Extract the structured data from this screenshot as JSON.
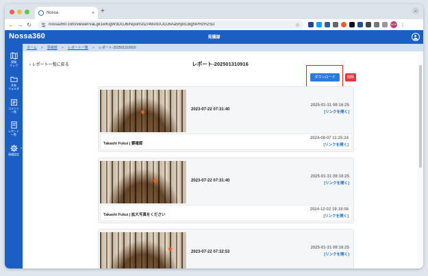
{
  "browser": {
    "tab_title": "Nossa",
    "tab_close": "×",
    "new_tab": "+",
    "tab_menu": "⌄",
    "url": "nossa360.com/viewer/xaLgk1wKigW3DGJ6/reports/tZr49srbXJOJ6Aa5hpnLblgNPRzH2SD",
    "nav": {
      "back": "←",
      "forward": "→",
      "reload": "↻"
    },
    "bookmark": "☆",
    "profile_label": "NOS",
    "traffic_colors": [
      "#ee5b54",
      "#f5bd3a",
      "#5fc84a"
    ],
    "ext_colors": [
      "#2c3e8f",
      "#1d9bf0",
      "#3b5998",
      "#666666",
      "#e85d2a",
      "#111111",
      "#1e4fa3",
      "#444444",
      "#777777",
      "#999999"
    ]
  },
  "app": {
    "logo": "Nossa360",
    "header_title": "見積部",
    "accent": "#1c5fc4"
  },
  "sidebar": {
    "items": [
      {
        "name": "map",
        "label": "現場\nマップ"
      },
      {
        "name": "shared-folder",
        "label": "共有\nフォルダ"
      },
      {
        "name": "comments",
        "label": "コメント\n一覧"
      },
      {
        "name": "reports",
        "label": "レポート\n一覧"
      },
      {
        "name": "settings",
        "label": "現場設定"
      }
    ],
    "arrow": "›"
  },
  "breadcrumb": {
    "home": "ホーム",
    "site": "見積部",
    "list": "レポート一覧",
    "current": "レポート-202501310916",
    "sep": ">"
  },
  "page": {
    "back": "‹ レポート一覧に戻る",
    "title": "レポート-202501310916",
    "download": "ダウンロード",
    "delete": "削除"
  },
  "cards": [
    {
      "captured": "2023-07-22 07:31:40",
      "report_date": "2025-01-31 09:16:25",
      "link": "[リンクを開く]",
      "comment": "Takashi Fukui | 要確認",
      "comment_date": "2024-08-07 11:25:24",
      "comment_link": "[リンクを開く]"
    },
    {
      "captured": "2023-07-22 07:31:40",
      "report_date": "2025-01-31 09:16:25",
      "link": "[リンクを開く]",
      "comment": "Takashi Fukui | 拡大写真をください",
      "comment_date": "2024-12-02 19:18:08",
      "comment_link": "[リンクを開く]"
    },
    {
      "captured": "2023-07-22 07:32:53",
      "report_date": "2025-01-31 09:16:25",
      "link": "[リンクを開く]"
    }
  ]
}
